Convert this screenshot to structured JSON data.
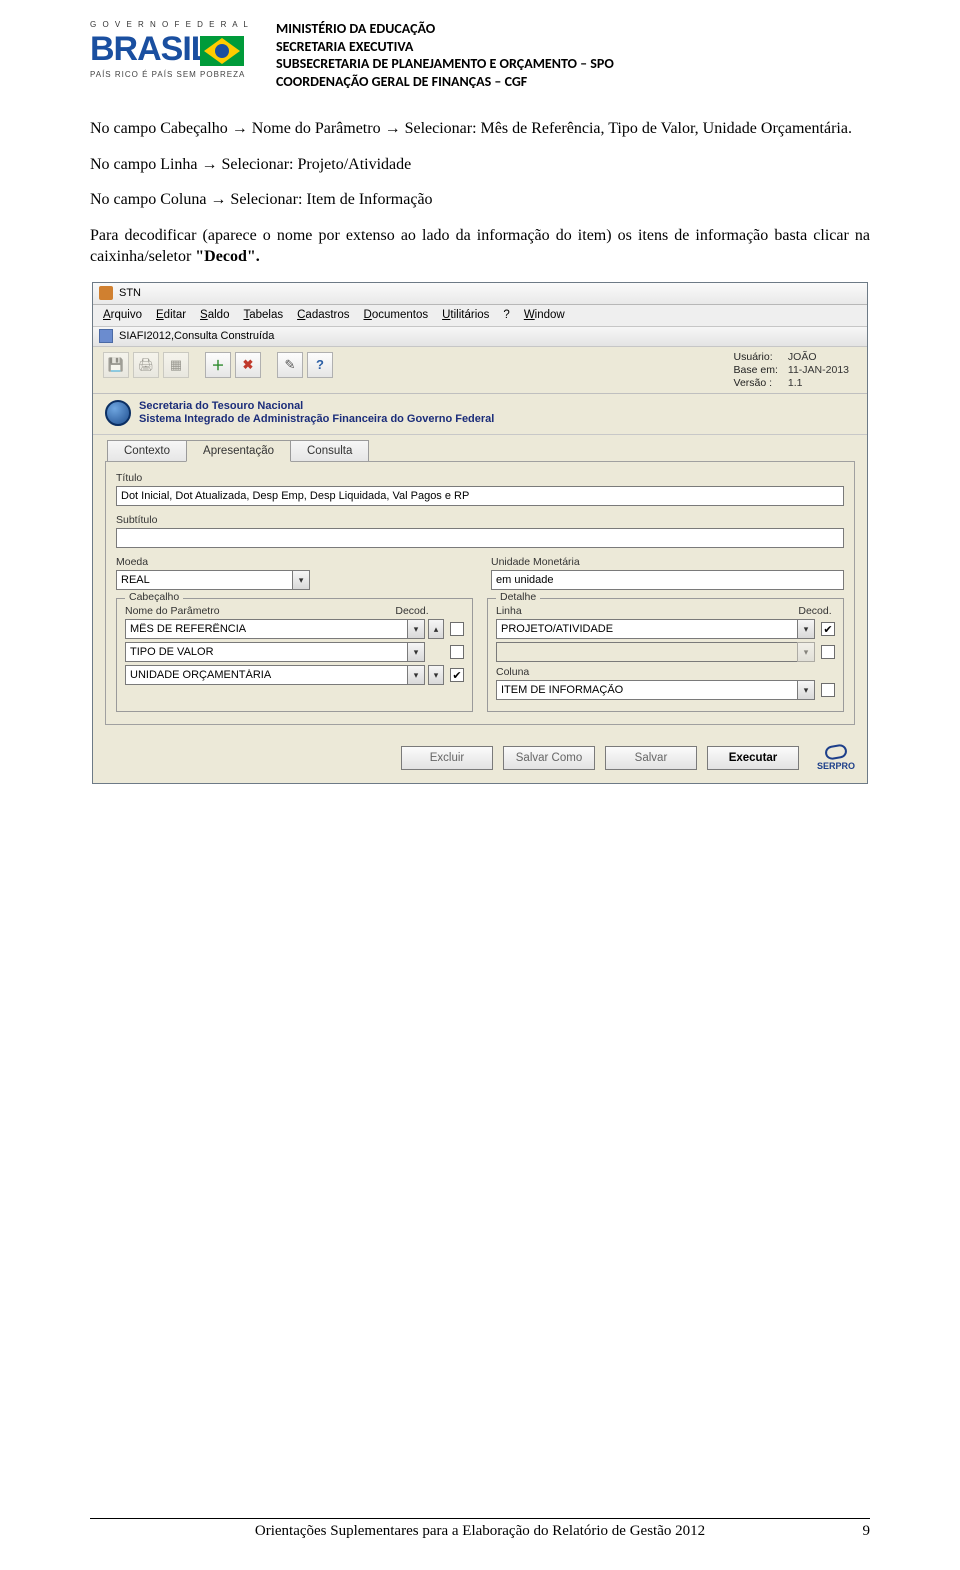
{
  "header": {
    "logo_top": "G O V E R N O   F E D E R A L",
    "logo_word": "BRASIL",
    "logo_tag": "PAÍS RICO É PAÍS SEM POBREZA",
    "lines": [
      "MINISTÉRIO DA EDUCAÇÃO",
      "SECRETARIA EXECUTIVA",
      "SUBSECRETARIA DE PLANEJAMENTO E ORÇAMENTO – SPO",
      "COORDENAÇÃO GERAL DE FINANÇAS – CGF"
    ]
  },
  "body": {
    "p1": "No campo Cabeçalho → Nome do Parâmetro → Selecionar: Mês de Referência, Tipo de Valor, Unidade Orçamentária.",
    "p2": "No campo Linha → Selecionar: Projeto/Atividade",
    "p3": "No campo Coluna → Selecionar: Item de Informação",
    "p4a": "Para decodificar (aparece o nome por extenso ao lado da informação do item) os itens de informação basta clicar na caixinha/seletor ",
    "p4b": "\"Decod\"."
  },
  "app": {
    "title": "STN",
    "subwindow": "SIAFI2012,Consulta Construída",
    "menus": [
      {
        "u": "A",
        "rest": "rquivo"
      },
      {
        "u": "E",
        "rest": "ditar"
      },
      {
        "u": "S",
        "rest": "aldo"
      },
      {
        "u": "T",
        "rest": "abelas"
      },
      {
        "u": "C",
        "rest": "adastros"
      },
      {
        "u": "D",
        "rest": "ocumentos"
      },
      {
        "u": "U",
        "rest": "tilitários"
      },
      {
        "u": "?",
        "rest": ""
      },
      {
        "u": "W",
        "rest": "indow"
      }
    ],
    "info": {
      "user_l": "Usuário:",
      "user_v": "JOÃO",
      "base_l": "Base em:",
      "base_v": "11-JAN-2013",
      "ver_l": "Versão :",
      "ver_v": "1.1"
    },
    "banner_l1": "Secretaria do Tesouro Nacional",
    "banner_l2": "Sistema Integrado de Administração Financeira do Governo Federal",
    "tabs": {
      "t1": "Contexto",
      "t2": "Apresentação",
      "t3": "Consulta"
    },
    "form": {
      "titulo_l": "Título",
      "titulo_v": "Dot Inicial, Dot Atualizada, Desp Emp, Desp Liquidada, Val Pagos e RP",
      "subtitulo_l": "Subtítulo",
      "subtitulo_v": "",
      "moeda_l": "Moeda",
      "moeda_v": "REAL",
      "unid_l": "Unidade Monetária",
      "unid_v": "em unidade",
      "cabecalho_l": "Cabeçalho",
      "nome_par_l": "Nome do Parâmetro",
      "decod_l": "Decod.",
      "params": {
        "p1": "MÊS DE REFERÊNCIA",
        "p2": "TIPO DE VALOR",
        "p3": "UNIDADE ORÇAMENTÁRIA"
      },
      "detalhe_l": "Detalhe",
      "linha_l": "Linha",
      "linha_v": "PROJETO/ATIVIDADE",
      "linha2_v": "",
      "coluna_l": "Coluna",
      "coluna_v": "ITEM DE INFORMAÇÃO"
    },
    "buttons": {
      "excluir": "Excluir",
      "salvar_como": "Salvar Como",
      "salvar": "Salvar",
      "executar": "Executar"
    },
    "serpro": "SERPRO"
  },
  "footer": {
    "text": "Orientações Suplementares para a Elaboração do Relatório de Gestão 2012",
    "page": "9"
  }
}
